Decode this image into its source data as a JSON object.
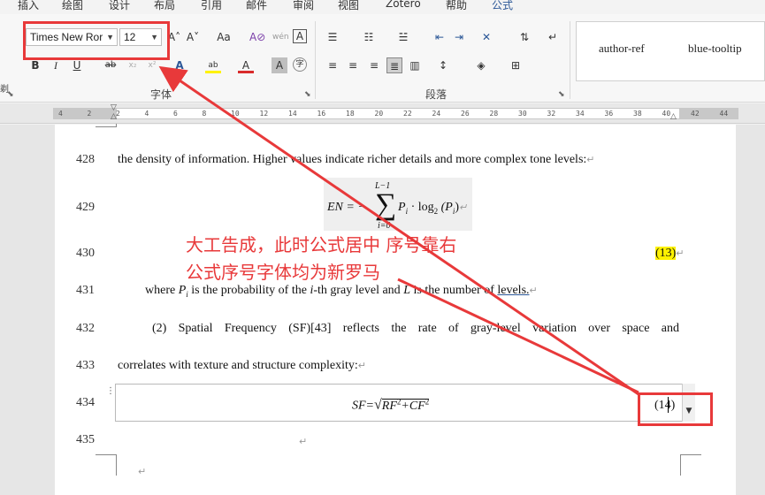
{
  "ribbon": {
    "tabs": [
      "插入",
      "绘图",
      "设计",
      "布局",
      "引用",
      "邮件",
      "审阅",
      "视图",
      "Zotero",
      "帮助",
      "公式"
    ],
    "font_name": "Times New Ror",
    "font_size": "12",
    "font_group_label": "字体",
    "paragraph_group_label": "段落",
    "side_text": "剃",
    "buttons": {
      "grow_font": "A˄",
      "shrink_font": "A˅",
      "change_case": "Aa",
      "clear_format": "A⊘",
      "phonetic": "wén",
      "char_border": "A",
      "bold": "B",
      "italic": "I",
      "underline": "U",
      "strike": "ab",
      "subscript": "x₂",
      "superscript": "x²",
      "text_effect": "A",
      "highlight": "ab",
      "font_color": "A",
      "char_shading": "A",
      "enclose": "字"
    },
    "styles": [
      "author-ref",
      "blue-tooltip"
    ],
    "colors": {
      "accent": "#2b5797",
      "highlight": "#fff200",
      "font_red": "#d92b2b",
      "annotation": "#e8393a"
    }
  },
  "ruler": {
    "ticks": [
      "4",
      "2",
      "2",
      "4",
      "6",
      "8",
      "10",
      "12",
      "14",
      "16",
      "18",
      "20",
      "22",
      "24",
      "26",
      "28",
      "30",
      "32",
      "34",
      "36",
      "38",
      "40",
      "42",
      "44"
    ]
  },
  "document": {
    "lines": [
      {
        "no": "428",
        "text": "the density of information. Higher values indicate richer details and more complex tone levels:"
      },
      {
        "no": "429",
        "text": ""
      },
      {
        "no": "430",
        "text": ""
      },
      {
        "no": "431",
        "text_parts": [
          "where ",
          "P",
          "i",
          " is the probability of the ",
          "i",
          "-th gray level and ",
          "L",
          " is the number of ",
          "levels."
        ]
      },
      {
        "no": "432",
        "words": [
          "(2)",
          "Spatial",
          "Frequency",
          "(SF)[43]",
          "reflects",
          "the",
          "rate",
          "of",
          "gray-level",
          "variation",
          "over",
          "space",
          "and"
        ]
      },
      {
        "no": "433",
        "text": "correlates with texture and structure complexity:"
      },
      {
        "no": "434",
        "text": ""
      },
      {
        "no": "435",
        "text": ""
      }
    ],
    "eq1": {
      "lhs": "EN = −",
      "sum_top": "L−1",
      "sum_bottom": "i=0",
      "body": "P",
      "sub": "i",
      "op": " · log",
      "log_sub": "2",
      "arg": " (P",
      "arg_sub": "i",
      "close": ")",
      "number": "(13)"
    },
    "eq2": {
      "lhs": "SF=",
      "body": "RF",
      "sup1": "2",
      "plus": "+CF",
      "sup2": "2",
      "number": "(14)"
    }
  },
  "annotation": {
    "line1": "大工告成，此时公式居中 序号靠右",
    "line2": "公式序号字体均为新罗马"
  }
}
